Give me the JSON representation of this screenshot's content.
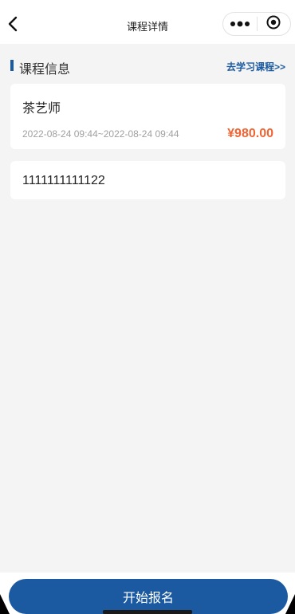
{
  "navbar": {
    "title": "课程详情",
    "back_icon": "chevron-left-icon",
    "more_icon": "more-dots-icon",
    "close_icon": "target-circle-icon"
  },
  "section": {
    "title": "课程信息",
    "link_label": "去学习课程>>"
  },
  "course": {
    "name": "茶艺师",
    "time_range": "2022-08-24 09:44~2022-08-24 09:44",
    "price": "¥980.00"
  },
  "description": {
    "text": "1111111111122"
  },
  "footer": {
    "signup_label": "开始报名"
  },
  "colors": {
    "accent": "#1b5aa0",
    "price": "#f06433",
    "background": "#f4f4f4"
  }
}
